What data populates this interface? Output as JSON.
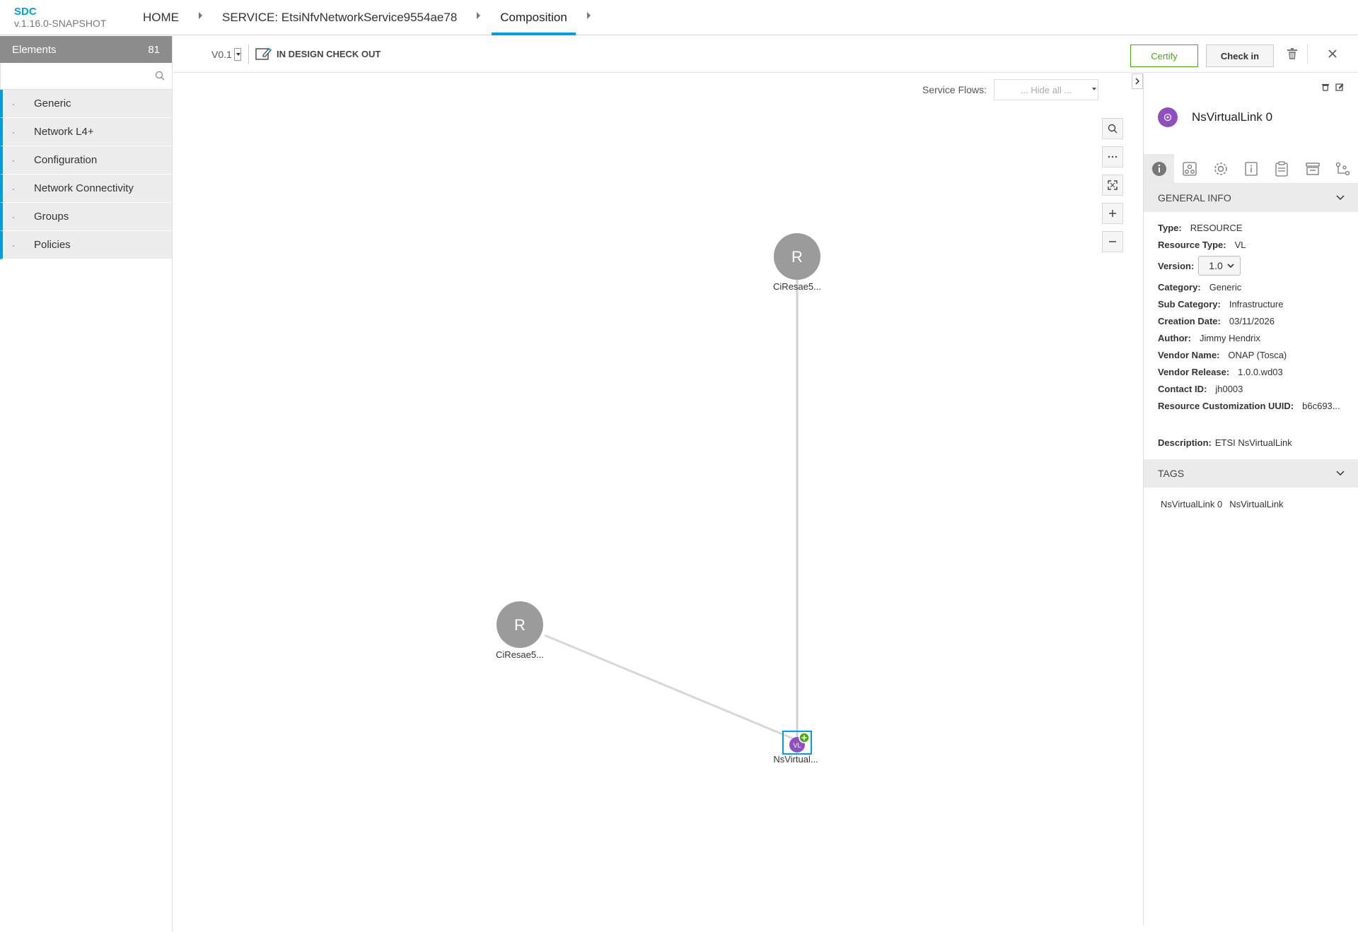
{
  "app": {
    "name": "SDC",
    "version": "v.1.16.0-SNAPSHOT"
  },
  "breadcrumbs": [
    {
      "label": "HOME"
    },
    {
      "label": "SERVICE: EtsiNfvNetworkService9554ae78"
    },
    {
      "label": "Composition"
    }
  ],
  "palette": {
    "title": "Elements",
    "count": "81",
    "search_placeholder": "",
    "items": [
      {
        "label": "Generic"
      },
      {
        "label": "Network L4+"
      },
      {
        "label": "Configuration"
      },
      {
        "label": "Network Connectivity"
      },
      {
        "label": "Groups"
      },
      {
        "label": "Policies"
      }
    ]
  },
  "workspace": {
    "version": "V0.1",
    "status": "IN DESIGN CHECK OUT",
    "certify_label": "Certify",
    "checkin_label": "Check in"
  },
  "canvas": {
    "service_flows_label": "Service Flows:",
    "service_flows_value": "... Hide all ...",
    "nodes": [
      {
        "letter": "R",
        "label": "CiResae5..."
      },
      {
        "letter": "R",
        "label": "CiResae5..."
      },
      {
        "letter": "VL",
        "label": "NsVirtual..."
      }
    ]
  },
  "panel": {
    "title": "NsVirtualLink 0",
    "general_info_title": "GENERAL INFO",
    "fields": [
      {
        "key": "Type:",
        "value": "RESOURCE"
      },
      {
        "key": "Resource Type:",
        "value": "VL"
      }
    ],
    "version_label": "Version:",
    "version_value": "1.0",
    "fields2": [
      {
        "key": "Category:",
        "value": "Generic"
      },
      {
        "key": "Sub Category:",
        "value": "Infrastructure"
      },
      {
        "key": "Creation Date:",
        "value": "03/11/2026"
      },
      {
        "key": "Author:",
        "value": "Jimmy Hendrix"
      },
      {
        "key": "Vendor Name:",
        "value": "ONAP (Tosca)"
      },
      {
        "key": "Vendor Release:",
        "value": "1.0.0.wd03"
      },
      {
        "key": "Contact ID:",
        "value": "jh0003"
      },
      {
        "key": "Resource Customization UUID:",
        "value": "b6c693..."
      }
    ],
    "description_label": "Description:",
    "description_value": "ETSI NsVirtualLink",
    "tags_title": "TAGS",
    "tags": [
      "NsVirtualLink 0",
      "NsVirtualLink"
    ]
  },
  "colors": {
    "accent": "#009fdb",
    "certify": "#4ca90c",
    "vl_node": "#8e4fbf",
    "resource_node": "#9b9b9b"
  }
}
